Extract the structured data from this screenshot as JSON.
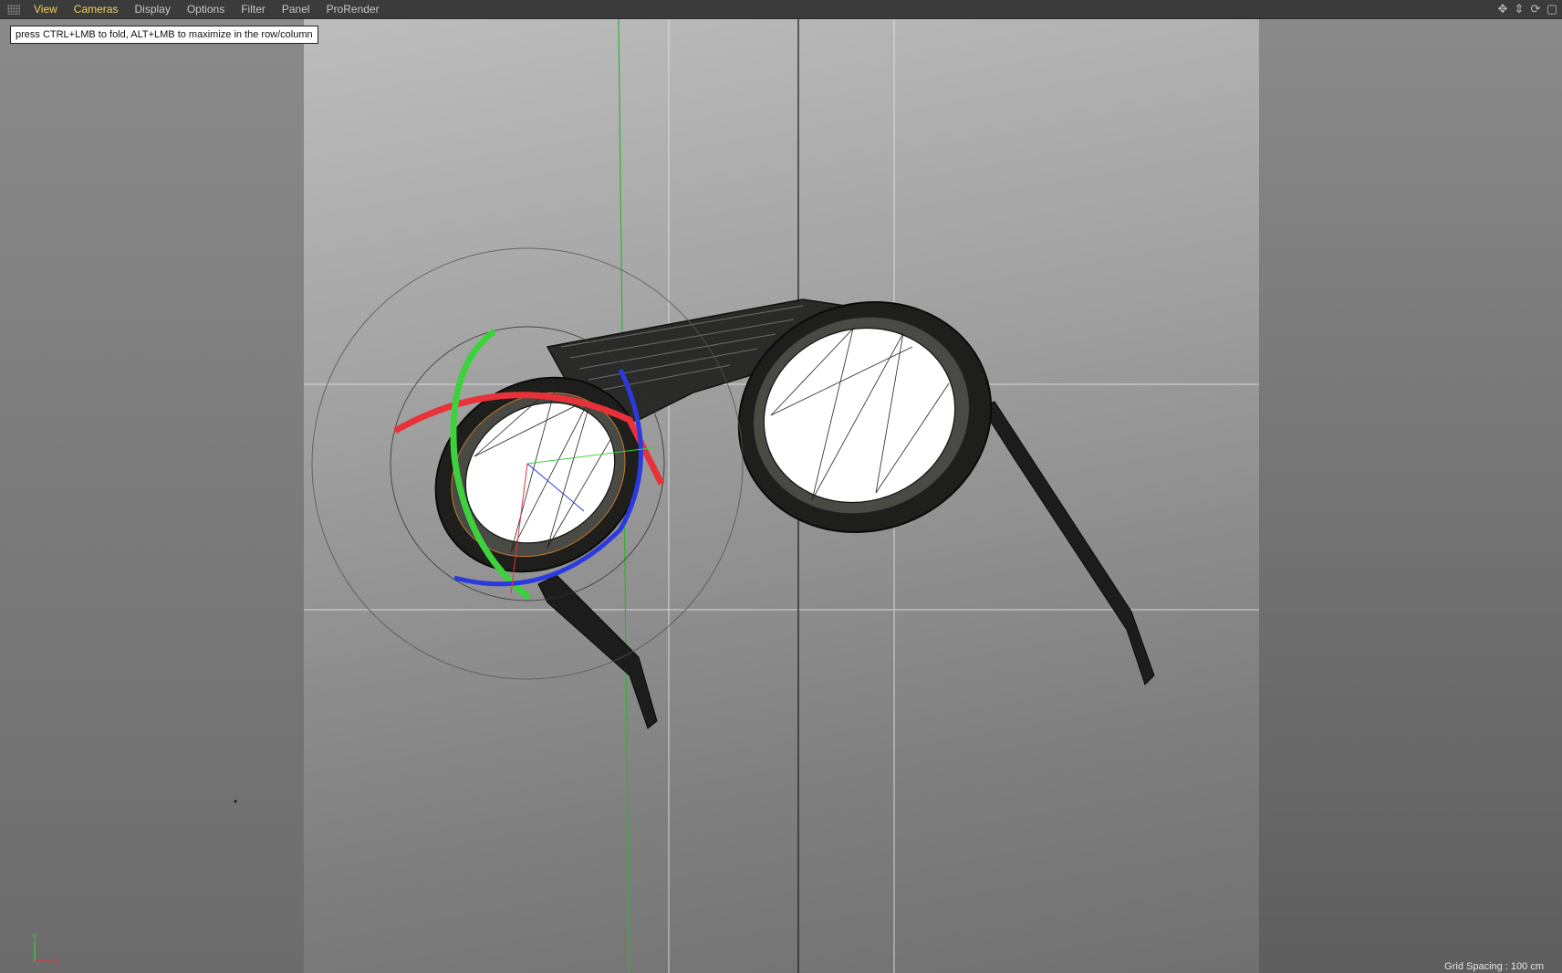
{
  "menu": {
    "items": [
      {
        "label": "View",
        "active": true
      },
      {
        "label": "Cameras",
        "active": true
      },
      {
        "label": "Display"
      },
      {
        "label": "Options"
      },
      {
        "label": "Filter"
      },
      {
        "label": "Panel"
      },
      {
        "label": "ProRender"
      }
    ],
    "nav_icons": [
      "move-view-icon",
      "dolly-view-icon",
      "rotate-view-icon",
      "toggle-panel-icon"
    ]
  },
  "viewport": {
    "tooltip": "press CTRL+LMB to fold, ALT+LMB to maximize in the row/column",
    "grid_spacing": "Grid Spacing : 100 cm",
    "axis_labels": {
      "y": "Y",
      "x": "X"
    }
  },
  "colors": {
    "gizmo_x": "#e8323a",
    "gizmo_y": "#3dd23d",
    "gizmo_z": "#2a3ae0",
    "active_menu": "#f2d35b"
  }
}
